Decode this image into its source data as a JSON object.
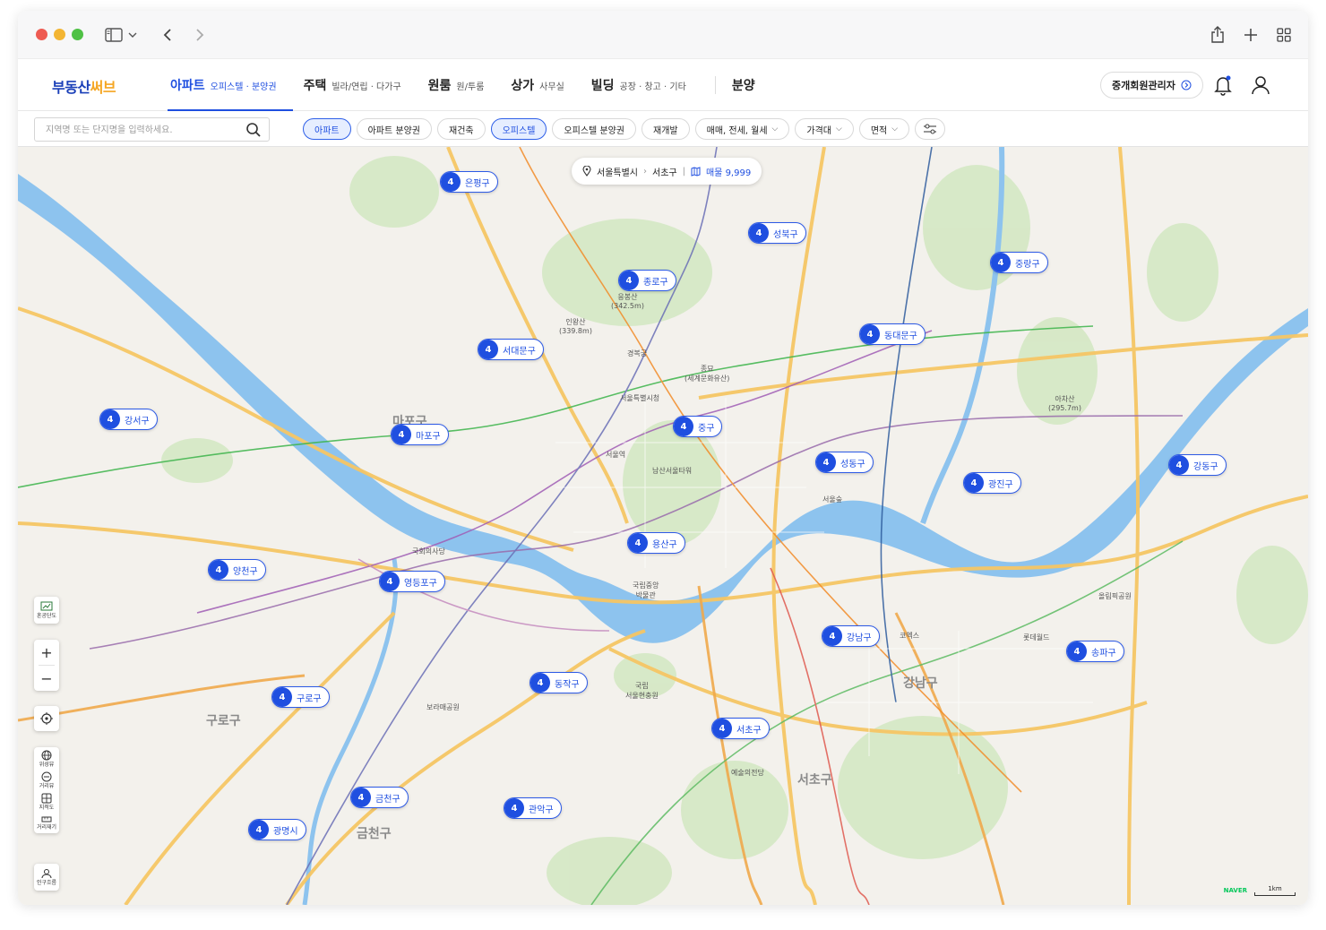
{
  "header": {
    "logo_part1": "부동산",
    "logo_part2": "써브",
    "nav": [
      {
        "main": "아파트",
        "sub": "오피스텔 · 분양권",
        "active": true
      },
      {
        "main": "주택",
        "sub": "빌라/연립 · 다가구"
      },
      {
        "main": "원룸",
        "sub": "원/투룸"
      },
      {
        "main": "상가",
        "sub": "사무실"
      },
      {
        "main": "빌딩",
        "sub": "공장 · 창고 · 기타"
      }
    ],
    "nav_extra": "분양",
    "agent_button": "중개회원관리자"
  },
  "filters": {
    "search_placeholder": "지역명 또는 단지명을 입력하세요.",
    "chips": [
      {
        "label": "아파트",
        "selected": true
      },
      {
        "label": "아파트 분양권"
      },
      {
        "label": "재건축"
      },
      {
        "label": "오피스텔",
        "selected": true
      },
      {
        "label": "오피스텔 분양권"
      },
      {
        "label": "재개발"
      },
      {
        "label": "매매, 전세, 월세",
        "dropdown": true
      },
      {
        "label": "가격대",
        "dropdown": true
      },
      {
        "label": "면적",
        "dropdown": true
      }
    ]
  },
  "map": {
    "breadcrumb": {
      "city": "서울특별시",
      "district": "서초구",
      "listings": "매물 9,999"
    },
    "markers": [
      {
        "count": "4",
        "name": "은평구"
      },
      {
        "count": "4",
        "name": "성북구"
      },
      {
        "count": "4",
        "name": "중랑구"
      },
      {
        "count": "4",
        "name": "종로구"
      },
      {
        "count": "4",
        "name": "동대문구"
      },
      {
        "count": "4",
        "name": "서대문구"
      },
      {
        "count": "4",
        "name": "강서구"
      },
      {
        "count": "4",
        "name": "마포구"
      },
      {
        "count": "4",
        "name": "중구"
      },
      {
        "count": "4",
        "name": "성동구"
      },
      {
        "count": "4",
        "name": "광진구"
      },
      {
        "count": "4",
        "name": "강동구"
      },
      {
        "count": "4",
        "name": "용산구"
      },
      {
        "count": "4",
        "name": "양천구"
      },
      {
        "count": "4",
        "name": "영등포구"
      },
      {
        "count": "4",
        "name": "강남구"
      },
      {
        "count": "4",
        "name": "송파구"
      },
      {
        "count": "4",
        "name": "구로구"
      },
      {
        "count": "4",
        "name": "동작구"
      },
      {
        "count": "4",
        "name": "서초구"
      },
      {
        "count": "4",
        "name": "금천구"
      },
      {
        "count": "4",
        "name": "관악구"
      },
      {
        "count": "4",
        "name": "광명시"
      }
    ],
    "labels": {
      "gyeongbokgung": "경복궁",
      "jongmyo": "종묘\n(세계문화유산)",
      "seoul_station": "서울역",
      "namsan_tower": "남산서울타워",
      "national_museum": "국립중앙\n박물관",
      "national_assembly": "국회의사당",
      "olympic_park": "올림픽공원",
      "lotte_world": "롯데월드",
      "arts_center": "예술의전당",
      "gangnam_big": "강남구",
      "seocho_big": "서초구",
      "guro_big": "구로구",
      "mapo_big": "마포구",
      "geumcheon_big": "금천구",
      "seoul_cityhall": "서울특별시청",
      "achasan": "아차산\n(295.7m)",
      "inwangsan": "인왕산\n(339.8m)",
      "ungbongsan": "응봉산\n(342.5m)",
      "coex": "코엑스",
      "seoul_forest": "서울숲",
      "boramae": "보라매공원",
      "national_cemetery": "국립\n서울현충원"
    },
    "controls": {
      "density": "혼공단도",
      "zoom_in": "+",
      "zoom_out": "−",
      "satellite": "위성뷰",
      "distance": "거리뷰",
      "cadastral": "지적도",
      "measure": "거리재기",
      "population": "인구흐름"
    },
    "attribution": {
      "naver": "NAVER",
      "scale": "1km"
    }
  },
  "colors": {
    "brand_blue": "#1f4fe0",
    "brand_orange": "#f5a623",
    "river": "#7fb8e8",
    "park": "#c9e4b8"
  }
}
